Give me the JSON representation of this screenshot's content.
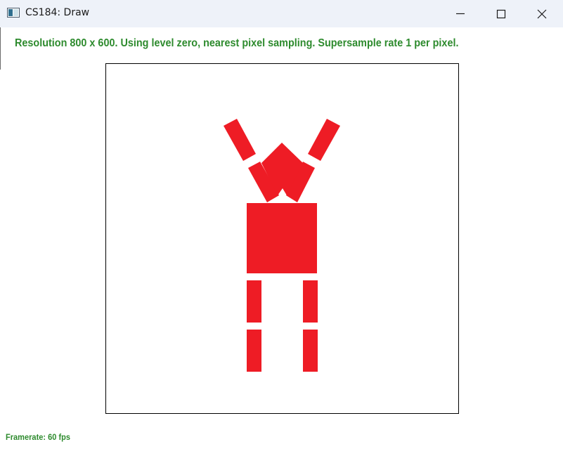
{
  "window": {
    "title": "CS184: Draw",
    "icon": "app-window-icon",
    "controls": [
      "minimize-icon",
      "maximize-icon",
      "close-icon"
    ]
  },
  "status": {
    "text": "Resolution 800 x 600. Using level zero, nearest pixel sampling. Supersample rate 1 per pixel."
  },
  "footer": {
    "framerate": "Framerate: 60 fps"
  },
  "drawing": {
    "fill_color": "#ee1c25",
    "figure": "stick-figure-red-rectangles",
    "parts": [
      "left-forearm",
      "right-forearm",
      "left-upper-arm",
      "right-upper-arm",
      "head",
      "torso",
      "left-thigh",
      "right-thigh",
      "left-shin",
      "right-shin"
    ]
  },
  "colors": {
    "status_text": "#2e8b2e",
    "titlebar_bg": "#eef2f9",
    "shape_fill": "#ee1c25"
  }
}
